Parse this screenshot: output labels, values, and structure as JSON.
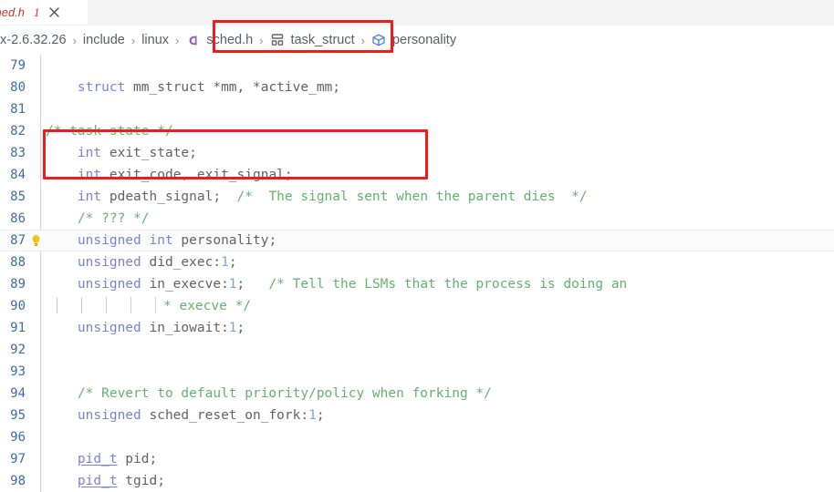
{
  "window": {
    "app": "code-editor"
  },
  "tab_bar": {
    "tabs": [
      {
        "label": "ched.h",
        "dirty_marker": "1",
        "close_icon": "close-icon",
        "active": true,
        "italic": true
      }
    ]
  },
  "breadcrumb": {
    "items": [
      {
        "label": "x-2.6.32.26",
        "icon": null
      },
      {
        "label": "include",
        "icon": null
      },
      {
        "label": "linux",
        "icon": null
      },
      {
        "label": "sched.h",
        "icon": "c-file-icon"
      },
      {
        "label": "task_struct",
        "icon": "structure-icon"
      },
      {
        "label": "personality",
        "icon": "field-icon"
      }
    ],
    "separator": "›"
  },
  "editor": {
    "active_line_number": "87",
    "glyph_icons": {
      "lightbulb": "lightbulb-icon"
    },
    "lines": [
      {
        "num": "79",
        "indent": 0,
        "glyph": null,
        "tokens": []
      },
      {
        "num": "80",
        "indent": 0,
        "glyph": null,
        "tokens": [
          {
            "t": "    ",
            "c": "pun"
          },
          {
            "t": "struct",
            "c": "kw"
          },
          {
            "t": " mm_struct *mm, *active_mm;",
            "c": "id"
          }
        ]
      },
      {
        "num": "81",
        "indent": 0,
        "glyph": null,
        "tokens": []
      },
      {
        "num": "82",
        "indent": 0,
        "glyph": null,
        "tokens": [
          {
            "t": "/* task state */",
            "c": "cmt"
          }
        ]
      },
      {
        "num": "83",
        "indent": 0,
        "glyph": null,
        "tokens": [
          {
            "t": "    ",
            "c": "pun"
          },
          {
            "t": "int",
            "c": "kw"
          },
          {
            "t": " exit_state;",
            "c": "id"
          }
        ]
      },
      {
        "num": "84",
        "indent": 0,
        "glyph": null,
        "tokens": [
          {
            "t": "    ",
            "c": "pun"
          },
          {
            "t": "int",
            "c": "kw"
          },
          {
            "t": " exit_code, exit_signal;",
            "c": "id"
          }
        ]
      },
      {
        "num": "85",
        "indent": 0,
        "glyph": null,
        "tokens": [
          {
            "t": "    ",
            "c": "pun"
          },
          {
            "t": "int",
            "c": "kw"
          },
          {
            "t": " pdeath_signal;  ",
            "c": "id"
          },
          {
            "t": "/*  The signal sent when the parent dies  */",
            "c": "cmt"
          }
        ]
      },
      {
        "num": "86",
        "indent": 0,
        "glyph": null,
        "tokens": [
          {
            "t": "    ",
            "c": "pun"
          },
          {
            "t": "/* ??? */",
            "c": "cmt"
          }
        ]
      },
      {
        "num": "87",
        "indent": 0,
        "glyph": "lightbulb-icon",
        "active": true,
        "tokens": [
          {
            "t": "    ",
            "c": "pun"
          },
          {
            "t": "unsigned int",
            "c": "kw"
          },
          {
            "t": " personality;",
            "c": "id"
          }
        ]
      },
      {
        "num": "88",
        "indent": 0,
        "glyph": null,
        "tokens": [
          {
            "t": "    ",
            "c": "pun"
          },
          {
            "t": "unsigned",
            "c": "kw"
          },
          {
            "t": " did_exec:",
            "c": "id"
          },
          {
            "t": "1",
            "c": "num"
          },
          {
            "t": ";",
            "c": "id"
          }
        ]
      },
      {
        "num": "89",
        "indent": 0,
        "glyph": null,
        "tokens": [
          {
            "t": "    ",
            "c": "pun"
          },
          {
            "t": "unsigned",
            "c": "kw"
          },
          {
            "t": " in_execve:",
            "c": "id"
          },
          {
            "t": "1",
            "c": "num"
          },
          {
            "t": ";   ",
            "c": "id"
          },
          {
            "t": "/* Tell the LSMs that the process is doing an",
            "c": "cmt"
          }
        ]
      },
      {
        "num": "90",
        "indent": 0,
        "glyph": null,
        "guides": true,
        "tokens": [
          {
            "t": "* execve */",
            "c": "cmt"
          }
        ]
      },
      {
        "num": "91",
        "indent": 0,
        "glyph": null,
        "tokens": [
          {
            "t": "    ",
            "c": "pun"
          },
          {
            "t": "unsigned",
            "c": "kw"
          },
          {
            "t": " in_iowait:",
            "c": "id"
          },
          {
            "t": "1",
            "c": "num"
          },
          {
            "t": ";",
            "c": "id"
          }
        ]
      },
      {
        "num": "92",
        "indent": 0,
        "glyph": null,
        "tokens": []
      },
      {
        "num": "93",
        "indent": 0,
        "glyph": null,
        "tokens": []
      },
      {
        "num": "94",
        "indent": 0,
        "glyph": null,
        "tokens": [
          {
            "t": "    ",
            "c": "pun"
          },
          {
            "t": "/* Revert to default priority/policy when forking */",
            "c": "cmt"
          }
        ]
      },
      {
        "num": "95",
        "indent": 0,
        "glyph": null,
        "tokens": [
          {
            "t": "    ",
            "c": "pun"
          },
          {
            "t": "unsigned",
            "c": "kw"
          },
          {
            "t": " sched_reset_on_fork:",
            "c": "id"
          },
          {
            "t": "1",
            "c": "num"
          },
          {
            "t": ";",
            "c": "id"
          }
        ]
      },
      {
        "num": "96",
        "indent": 0,
        "glyph": null,
        "tokens": []
      },
      {
        "num": "97",
        "indent": 0,
        "glyph": null,
        "tokens": [
          {
            "t": "    ",
            "c": "pun"
          },
          {
            "t": "pid_t",
            "c": "typ"
          },
          {
            "t": " pid;",
            "c": "id"
          }
        ]
      },
      {
        "num": "98",
        "indent": 0,
        "glyph": null,
        "tokens": [
          {
            "t": "    ",
            "c": "pun"
          },
          {
            "t": "pid_t",
            "c": "typ"
          },
          {
            "t": " tgid;",
            "c": "id"
          }
        ]
      }
    ]
  },
  "annotations": [
    {
      "name": "breadcrumb-highlight",
      "color": "#f01b1b"
    },
    {
      "name": "code-highlight",
      "color": "#f01b1b"
    }
  ],
  "colors": {
    "keyword": "#7c83d6",
    "comment": "#62b36f",
    "identifier": "#636363",
    "number": "#7aa6d8",
    "line_number": "#3b6ea8",
    "annotation_red": "#f01b1b",
    "tab_bar_bg": "#f3f3f3",
    "lightbulb": "#e5b700"
  }
}
